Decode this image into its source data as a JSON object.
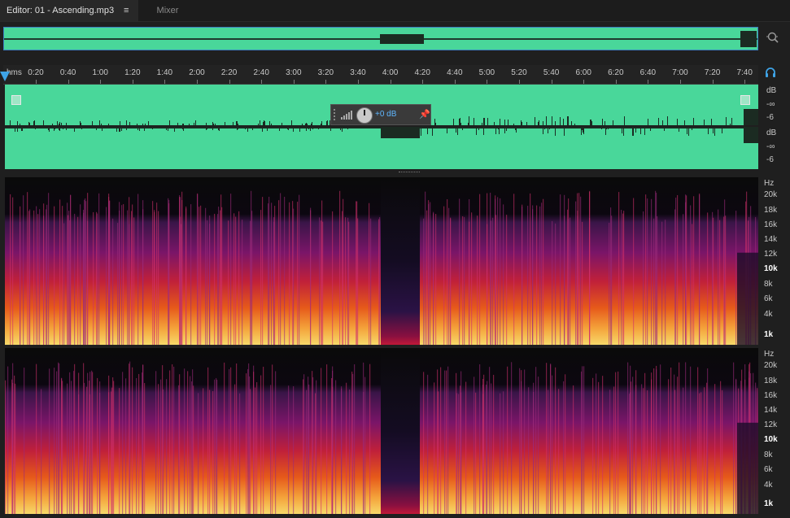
{
  "tabs": {
    "editor_label": "Editor: 01 - Ascending.mp3",
    "menu_icon": "≡",
    "mixer_label": "Mixer"
  },
  "overview": {
    "zoom_icon": "zoom-selection-icon"
  },
  "ruler": {
    "unit": "hms",
    "ticks": [
      "0:20",
      "0:40",
      "1:00",
      "1:20",
      "1:40",
      "2:00",
      "2:20",
      "2:40",
      "3:00",
      "3:20",
      "3:40",
      "4:00",
      "4:20",
      "4:40",
      "5:00",
      "5:20",
      "5:40",
      "6:00",
      "6:20",
      "6:40",
      "7:00",
      "7:20",
      "7:40"
    ]
  },
  "hud": {
    "volume": "+0 dB"
  },
  "db_scale": {
    "ch1": [
      "dB",
      "-∞",
      "-6"
    ],
    "ch2": [
      "dB",
      "-∞",
      "-6"
    ]
  },
  "hz_scale": {
    "labels": [
      "Hz",
      "20k",
      "18k",
      "16k",
      "14k",
      "12k",
      "10k",
      "8k",
      "6k",
      "4k",
      "1k"
    ]
  },
  "colors": {
    "waveform": "#49d79a",
    "accent": "#3ea3e6"
  }
}
